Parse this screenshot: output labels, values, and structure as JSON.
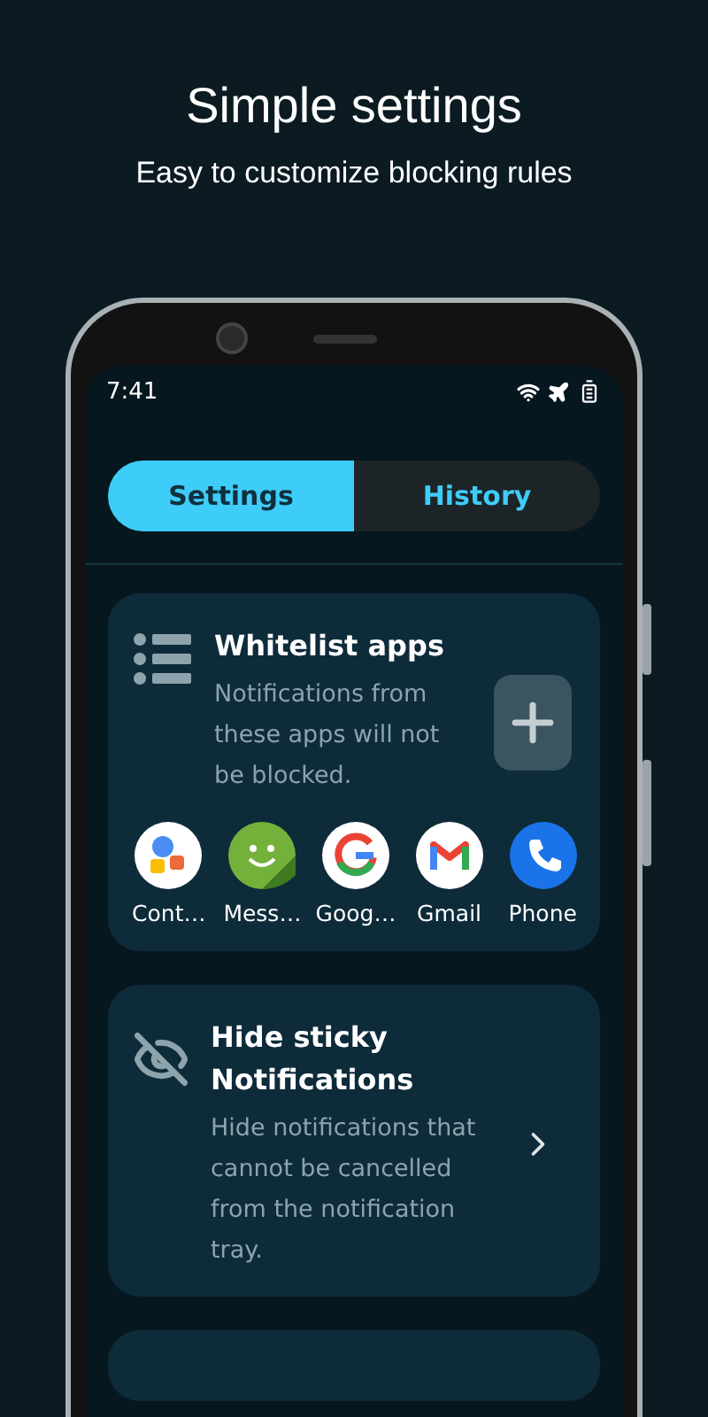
{
  "header": {
    "title": "Simple settings",
    "subtitle": "Easy to customize blocking rules"
  },
  "status_bar": {
    "time": "7:41"
  },
  "tabs": [
    {
      "label": "Settings",
      "selected": true
    },
    {
      "label": "History",
      "selected": false
    }
  ],
  "cards": [
    {
      "kind": "apps",
      "title": "Whitelist apps",
      "description": "Notifications from these apps will not be blocked.",
      "apps": [
        {
          "kind": "contacts",
          "label": "Cont…"
        },
        {
          "kind": "messenger",
          "label": "Mess…"
        },
        {
          "kind": "google",
          "label": "Goog…"
        },
        {
          "kind": "gmail",
          "label": "Gmail"
        },
        {
          "kind": "phone",
          "label": "Phone"
        }
      ]
    },
    {
      "kind": "link",
      "title": "Hide sticky Notifications",
      "description": "Hide notifications that cannot be cancelled from the notification tray."
    },
    {
      "kind": "partial"
    }
  ]
}
